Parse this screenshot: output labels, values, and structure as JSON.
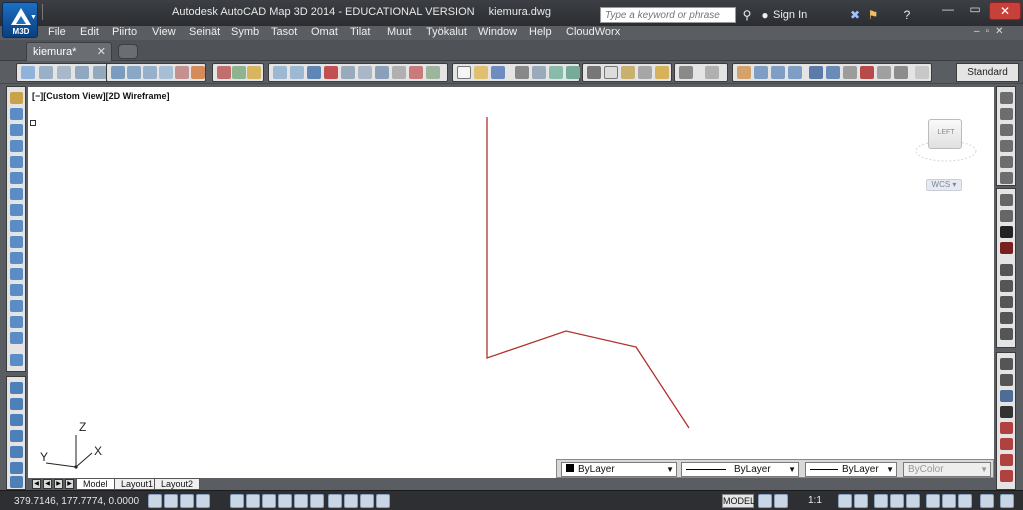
{
  "app": {
    "logo_label": "M3D",
    "title": "Autodesk AutoCAD Map 3D 2014 - EDUCATIONAL VERSION",
    "filename": "kiemura.dwg"
  },
  "search": {
    "placeholder": "Type a keyword or phrase"
  },
  "account": {
    "signin_label": "Sign In"
  },
  "menu": {
    "items": [
      "File",
      "Edit",
      "Piirto",
      "View",
      "Seinät",
      "Symb",
      "Tasot",
      "Omat",
      "Tilat",
      "Muut",
      "Työkalut",
      "Window",
      "Help",
      "CloudWorx"
    ]
  },
  "file_tabs": {
    "active": "kiemura*"
  },
  "toolbar": {
    "text_style": "Standard"
  },
  "viewport": {
    "label": "[−][Custom View][2D Wireframe]",
    "viewcube_face": "LEFT",
    "wcs_label": "WCS",
    "ucs_x": "X",
    "ucs_y": "Y",
    "ucs_z": "Z",
    "polyline_color": "#b0322c"
  },
  "layout_tabs": [
    "Model",
    "Layout1",
    "Layout2"
  ],
  "properties": {
    "color": "ByLayer",
    "linetype": "ByLayer",
    "lineweight": "ByLayer",
    "plotstyle": "ByColor"
  },
  "status": {
    "coordinates": "379.7146, 177.7774, 0.0000",
    "space": "MODEL",
    "annotation_scale": "1:1"
  }
}
